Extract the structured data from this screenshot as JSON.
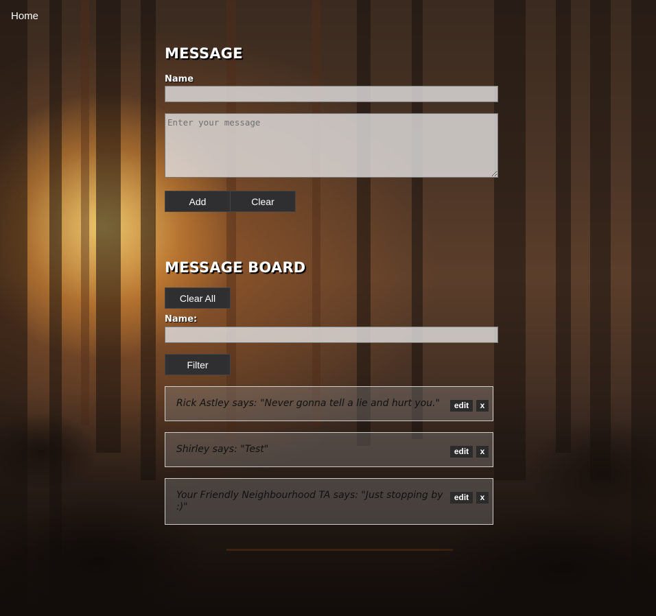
{
  "nav": {
    "home_label": "Home"
  },
  "compose": {
    "title": "MESSAGE",
    "name_label": "Name",
    "name_value": "",
    "message_placeholder": "Enter your message",
    "add_label": "Add",
    "clear_label": "Clear"
  },
  "board": {
    "title": "MESSAGE BOARD",
    "clear_all_label": "Clear All",
    "filter_name_label": "Name:",
    "filter_value": "",
    "filter_label": "Filter",
    "edit_label": "edit",
    "delete_label": "x",
    "messages": [
      {
        "text": "Rick Astley says: \"Never gonna tell a lie and hurt you.\""
      },
      {
        "text": "Shirley says: \"Test\""
      },
      {
        "text": "Your Friendly Neighbourhood TA says: \"Just stopping by :)\""
      }
    ]
  },
  "colors": {
    "button_bg": "#2f2f31",
    "input_bg": "#e1dede",
    "card_border": "#e6e6e6"
  }
}
